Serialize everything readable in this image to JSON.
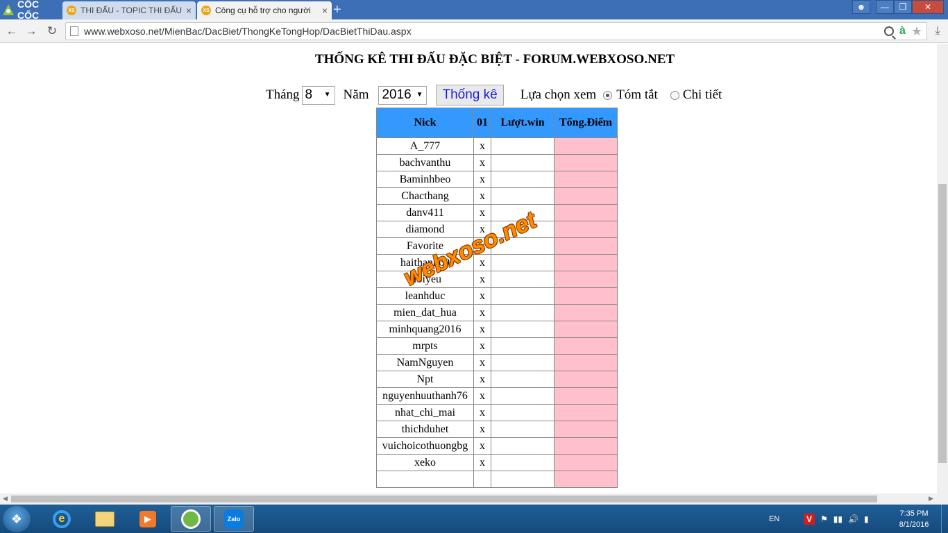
{
  "browser": {
    "brand": "CỐC CỐC",
    "tabs": [
      {
        "label": "THI ĐẤU - TOPIC THI ĐẤU",
        "favicon": "XS"
      },
      {
        "label": "Công cụ hỗ trợ cho người",
        "favicon": "XS"
      }
    ],
    "url": "www.webxoso.net/MienBac/DacBiet/ThongKeTongHop/DacBietThiDau.aspx"
  },
  "page": {
    "title": "THỐNG KÊ THI ĐẤU ĐẶC BIỆT - FORUM.WEBXOSO.NET",
    "filters": {
      "month_label": "Tháng",
      "month_value": "8",
      "year_label": "Năm",
      "year_value": "2016",
      "stat_button": "Thống kê",
      "view_label": "Lựa chọn xem",
      "view_options": [
        "Tóm tắt",
        "Chi tiết"
      ],
      "view_selected": "Tóm tắt"
    },
    "table": {
      "headers": [
        "Nick",
        "01",
        "Lượt.win",
        "Tổng.Điểm"
      ],
      "rows": [
        {
          "nick": "A_777",
          "d01": "x"
        },
        {
          "nick": "bachvanthu",
          "d01": "x"
        },
        {
          "nick": "Baminhbeo",
          "d01": "x"
        },
        {
          "nick": "Chacthang",
          "d01": "x"
        },
        {
          "nick": "danv411",
          "d01": "x"
        },
        {
          "nick": "diamond",
          "d01": "x"
        },
        {
          "nick": "Favorite",
          "d01": "x"
        },
        {
          "nick": "haithanh69",
          "d01": "x"
        },
        {
          "nick": "Hoiyeu",
          "d01": "x"
        },
        {
          "nick": "leanhduc",
          "d01": "x"
        },
        {
          "nick": "mien_dat_hua",
          "d01": "x"
        },
        {
          "nick": "minhquang2016",
          "d01": "x"
        },
        {
          "nick": "mrpts",
          "d01": "x"
        },
        {
          "nick": "NamNguyen",
          "d01": "x"
        },
        {
          "nick": "Npt",
          "d01": "x"
        },
        {
          "nick": "nguyenhuuthanh76",
          "d01": "x"
        },
        {
          "nick": "nhat_chi_mai",
          "d01": "x"
        },
        {
          "nick": "thichduhet",
          "d01": "x"
        },
        {
          "nick": "vuichoicothuongbg",
          "d01": "x"
        },
        {
          "nick": "xeko",
          "d01": "x"
        },
        {
          "nick": "",
          "d01": ""
        }
      ]
    },
    "watermark": "webxoso.net"
  },
  "taskbar": {
    "zalo_label": "Zalo",
    "language": "EN",
    "time": "7:35 PM",
    "date": "8/1/2016"
  },
  "colors": {
    "header_blue": "#3399ff",
    "points_pink": "#ffc0cb",
    "titlebar": "#3c6fb6",
    "watermark_orange": "#ff8c00"
  }
}
